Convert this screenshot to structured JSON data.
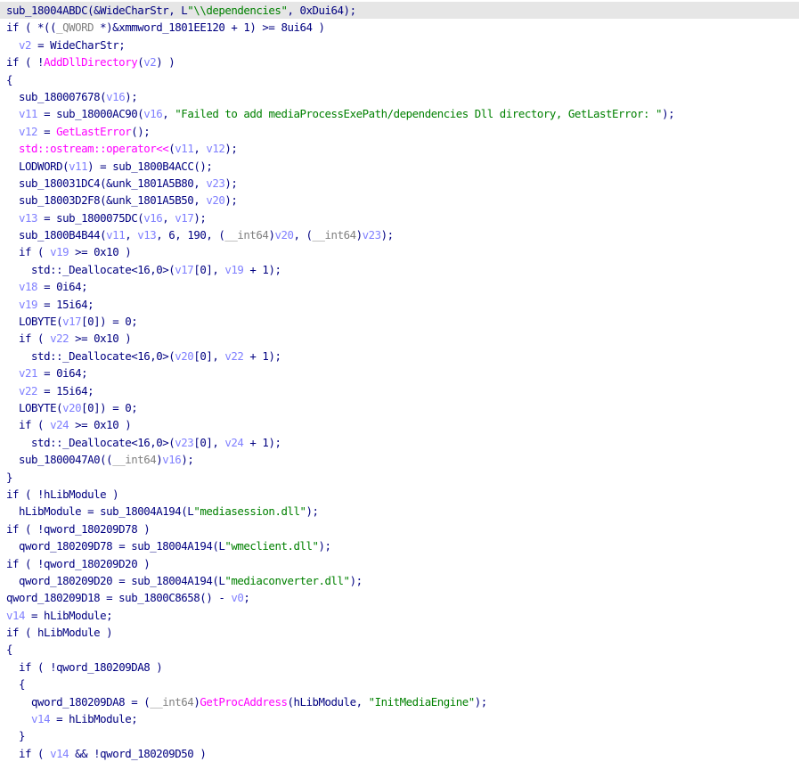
{
  "colors": {
    "plain": "#000080",
    "variable": "#8080ff",
    "string": "#008000",
    "import_function": "#ff00ff",
    "type_cast": "#808080",
    "highlight_line": "#e6e6e6",
    "background": "#ffffff"
  },
  "code_lines": [
    {
      "indent": "",
      "highlighted": true,
      "tokens": [
        {
          "c": "plain",
          "t": "sub_18004ABDC(&WideCharStr, L"
        },
        {
          "c": "str",
          "t": "\"\\\\dependencies\""
        },
        {
          "c": "plain",
          "t": ", 0xDui64);"
        }
      ]
    },
    {
      "indent": "",
      "tokens": [
        {
          "c": "plain",
          "t": "if ( *(("
        },
        {
          "c": "gray",
          "t": "_QWORD"
        },
        {
          "c": "plain",
          "t": " *)&xmmword_1801EE120 + 1) >= 8ui64 )"
        }
      ]
    },
    {
      "indent": "  ",
      "tokens": [
        {
          "c": "var",
          "t": "v2"
        },
        {
          "c": "plain",
          "t": " = WideCharStr;"
        }
      ]
    },
    {
      "indent": "",
      "tokens": [
        {
          "c": "plain",
          "t": "if ( !"
        },
        {
          "c": "func",
          "t": "AddDllDirectory"
        },
        {
          "c": "plain",
          "t": "("
        },
        {
          "c": "var",
          "t": "v2"
        },
        {
          "c": "plain",
          "t": ") )"
        }
      ]
    },
    {
      "indent": "",
      "tokens": [
        {
          "c": "plain",
          "t": "{"
        }
      ]
    },
    {
      "indent": "  ",
      "tokens": [
        {
          "c": "plain",
          "t": "sub_180007678("
        },
        {
          "c": "var",
          "t": "v16"
        },
        {
          "c": "plain",
          "t": ");"
        }
      ]
    },
    {
      "indent": "  ",
      "tokens": [
        {
          "c": "var",
          "t": "v11"
        },
        {
          "c": "plain",
          "t": " = sub_18000AC90("
        },
        {
          "c": "var",
          "t": "v16"
        },
        {
          "c": "plain",
          "t": ", "
        },
        {
          "c": "str",
          "t": "\"Failed to add mediaProcessExePath/dependencies Dll directory, GetLastError: \""
        },
        {
          "c": "plain",
          "t": ");"
        }
      ]
    },
    {
      "indent": "  ",
      "tokens": [
        {
          "c": "var",
          "t": "v12"
        },
        {
          "c": "plain",
          "t": " = "
        },
        {
          "c": "func",
          "t": "GetLastError"
        },
        {
          "c": "plain",
          "t": "();"
        }
      ]
    },
    {
      "indent": "  ",
      "tokens": [
        {
          "c": "func",
          "t": "std::ostream::operator<<"
        },
        {
          "c": "plain",
          "t": "("
        },
        {
          "c": "var",
          "t": "v11"
        },
        {
          "c": "plain",
          "t": ", "
        },
        {
          "c": "var",
          "t": "v12"
        },
        {
          "c": "plain",
          "t": ");"
        }
      ]
    },
    {
      "indent": "  ",
      "tokens": [
        {
          "c": "plain",
          "t": "LODWORD("
        },
        {
          "c": "var",
          "t": "v11"
        },
        {
          "c": "plain",
          "t": ") = sub_1800B4ACC();"
        }
      ]
    },
    {
      "indent": "  ",
      "tokens": [
        {
          "c": "plain",
          "t": "sub_180031DC4(&unk_1801A5B80, "
        },
        {
          "c": "var",
          "t": "v23"
        },
        {
          "c": "plain",
          "t": ");"
        }
      ]
    },
    {
      "indent": "  ",
      "tokens": [
        {
          "c": "plain",
          "t": "sub_18003D2F8(&unk_1801A5B50, "
        },
        {
          "c": "var",
          "t": "v20"
        },
        {
          "c": "plain",
          "t": ");"
        }
      ]
    },
    {
      "indent": "  ",
      "tokens": [
        {
          "c": "var",
          "t": "v13"
        },
        {
          "c": "plain",
          "t": " = sub_1800075DC("
        },
        {
          "c": "var",
          "t": "v16"
        },
        {
          "c": "plain",
          "t": ", "
        },
        {
          "c": "var",
          "t": "v17"
        },
        {
          "c": "plain",
          "t": ");"
        }
      ]
    },
    {
      "indent": "  ",
      "tokens": [
        {
          "c": "plain",
          "t": "sub_1800B4B44("
        },
        {
          "c": "var",
          "t": "v11"
        },
        {
          "c": "plain",
          "t": ", "
        },
        {
          "c": "var",
          "t": "v13"
        },
        {
          "c": "plain",
          "t": ", 6, 190, ("
        },
        {
          "c": "gray",
          "t": "__int64"
        },
        {
          "c": "plain",
          "t": ")"
        },
        {
          "c": "var",
          "t": "v20"
        },
        {
          "c": "plain",
          "t": ", ("
        },
        {
          "c": "gray",
          "t": "__int64"
        },
        {
          "c": "plain",
          "t": ")"
        },
        {
          "c": "var",
          "t": "v23"
        },
        {
          "c": "plain",
          "t": ");"
        }
      ]
    },
    {
      "indent": "  ",
      "tokens": [
        {
          "c": "plain",
          "t": "if ( "
        },
        {
          "c": "var",
          "t": "v19"
        },
        {
          "c": "plain",
          "t": " >= 0x10 )"
        }
      ]
    },
    {
      "indent": "    ",
      "tokens": [
        {
          "c": "plain",
          "t": "std::_Deallocate<16,0>("
        },
        {
          "c": "var",
          "t": "v17"
        },
        {
          "c": "plain",
          "t": "[0], "
        },
        {
          "c": "var",
          "t": "v19"
        },
        {
          "c": "plain",
          "t": " + 1);"
        }
      ]
    },
    {
      "indent": "  ",
      "tokens": [
        {
          "c": "var",
          "t": "v18"
        },
        {
          "c": "plain",
          "t": " = 0i64;"
        }
      ]
    },
    {
      "indent": "  ",
      "tokens": [
        {
          "c": "var",
          "t": "v19"
        },
        {
          "c": "plain",
          "t": " = 15i64;"
        }
      ]
    },
    {
      "indent": "  ",
      "tokens": [
        {
          "c": "plain",
          "t": "LOBYTE("
        },
        {
          "c": "var",
          "t": "v17"
        },
        {
          "c": "plain",
          "t": "[0]) = 0;"
        }
      ]
    },
    {
      "indent": "  ",
      "tokens": [
        {
          "c": "plain",
          "t": "if ( "
        },
        {
          "c": "var",
          "t": "v22"
        },
        {
          "c": "plain",
          "t": " >= 0x10 )"
        }
      ]
    },
    {
      "indent": "    ",
      "tokens": [
        {
          "c": "plain",
          "t": "std::_Deallocate<16,0>("
        },
        {
          "c": "var",
          "t": "v20"
        },
        {
          "c": "plain",
          "t": "[0], "
        },
        {
          "c": "var",
          "t": "v22"
        },
        {
          "c": "plain",
          "t": " + 1);"
        }
      ]
    },
    {
      "indent": "  ",
      "tokens": [
        {
          "c": "var",
          "t": "v21"
        },
        {
          "c": "plain",
          "t": " = 0i64;"
        }
      ]
    },
    {
      "indent": "  ",
      "tokens": [
        {
          "c": "var",
          "t": "v22"
        },
        {
          "c": "plain",
          "t": " = 15i64;"
        }
      ]
    },
    {
      "indent": "  ",
      "tokens": [
        {
          "c": "plain",
          "t": "LOBYTE("
        },
        {
          "c": "var",
          "t": "v20"
        },
        {
          "c": "plain",
          "t": "[0]) = 0;"
        }
      ]
    },
    {
      "indent": "  ",
      "tokens": [
        {
          "c": "plain",
          "t": "if ( "
        },
        {
          "c": "var",
          "t": "v24"
        },
        {
          "c": "plain",
          "t": " >= 0x10 )"
        }
      ]
    },
    {
      "indent": "    ",
      "tokens": [
        {
          "c": "plain",
          "t": "std::_Deallocate<16,0>("
        },
        {
          "c": "var",
          "t": "v23"
        },
        {
          "c": "plain",
          "t": "[0], "
        },
        {
          "c": "var",
          "t": "v24"
        },
        {
          "c": "plain",
          "t": " + 1);"
        }
      ]
    },
    {
      "indent": "  ",
      "tokens": [
        {
          "c": "plain",
          "t": "sub_1800047A0(("
        },
        {
          "c": "gray",
          "t": "__int64"
        },
        {
          "c": "plain",
          "t": ")"
        },
        {
          "c": "var",
          "t": "v16"
        },
        {
          "c": "plain",
          "t": ");"
        }
      ]
    },
    {
      "indent": "",
      "tokens": [
        {
          "c": "plain",
          "t": "}"
        }
      ]
    },
    {
      "indent": "",
      "tokens": [
        {
          "c": "plain",
          "t": "if ( !hLibModule )"
        }
      ]
    },
    {
      "indent": "  ",
      "tokens": [
        {
          "c": "plain",
          "t": "hLibModule = sub_18004A194(L"
        },
        {
          "c": "str",
          "t": "\"mediasession.dll\""
        },
        {
          "c": "plain",
          "t": ");"
        }
      ]
    },
    {
      "indent": "",
      "tokens": [
        {
          "c": "plain",
          "t": "if ( !qword_180209D78 )"
        }
      ]
    },
    {
      "indent": "  ",
      "tokens": [
        {
          "c": "plain",
          "t": "qword_180209D78 = sub_18004A194(L"
        },
        {
          "c": "str",
          "t": "\"wmeclient.dll\""
        },
        {
          "c": "plain",
          "t": ");"
        }
      ]
    },
    {
      "indent": "",
      "tokens": [
        {
          "c": "plain",
          "t": "if ( !qword_180209D20 )"
        }
      ]
    },
    {
      "indent": "  ",
      "tokens": [
        {
          "c": "plain",
          "t": "qword_180209D20 = sub_18004A194(L"
        },
        {
          "c": "str",
          "t": "\"mediaconverter.dll\""
        },
        {
          "c": "plain",
          "t": ");"
        }
      ]
    },
    {
      "indent": "",
      "tokens": [
        {
          "c": "plain",
          "t": "qword_180209D18 = sub_1800C8658() - "
        },
        {
          "c": "var",
          "t": "v0"
        },
        {
          "c": "plain",
          "t": ";"
        }
      ]
    },
    {
      "indent": "",
      "tokens": [
        {
          "c": "var",
          "t": "v14"
        },
        {
          "c": "plain",
          "t": " = hLibModule;"
        }
      ]
    },
    {
      "indent": "",
      "tokens": [
        {
          "c": "plain",
          "t": "if ( hLibModule )"
        }
      ]
    },
    {
      "indent": "",
      "tokens": [
        {
          "c": "plain",
          "t": "{"
        }
      ]
    },
    {
      "indent": "  ",
      "tokens": [
        {
          "c": "plain",
          "t": "if ( !qword_180209DA8 )"
        }
      ]
    },
    {
      "indent": "  ",
      "tokens": [
        {
          "c": "plain",
          "t": "{"
        }
      ]
    },
    {
      "indent": "    ",
      "tokens": [
        {
          "c": "plain",
          "t": "qword_180209DA8 = ("
        },
        {
          "c": "gray",
          "t": "__int64"
        },
        {
          "c": "plain",
          "t": ")"
        },
        {
          "c": "func",
          "t": "GetProcAddress"
        },
        {
          "c": "plain",
          "t": "(hLibModule, "
        },
        {
          "c": "str",
          "t": "\"InitMediaEngine\""
        },
        {
          "c": "plain",
          "t": ");"
        }
      ]
    },
    {
      "indent": "    ",
      "tokens": [
        {
          "c": "var",
          "t": "v14"
        },
        {
          "c": "plain",
          "t": " = hLibModule;"
        }
      ]
    },
    {
      "indent": "  ",
      "tokens": [
        {
          "c": "plain",
          "t": "}"
        }
      ]
    },
    {
      "indent": "  ",
      "tokens": [
        {
          "c": "plain",
          "t": "if ( "
        },
        {
          "c": "var",
          "t": "v14"
        },
        {
          "c": "plain",
          "t": " && !qword_180209D50 )"
        }
      ]
    }
  ]
}
